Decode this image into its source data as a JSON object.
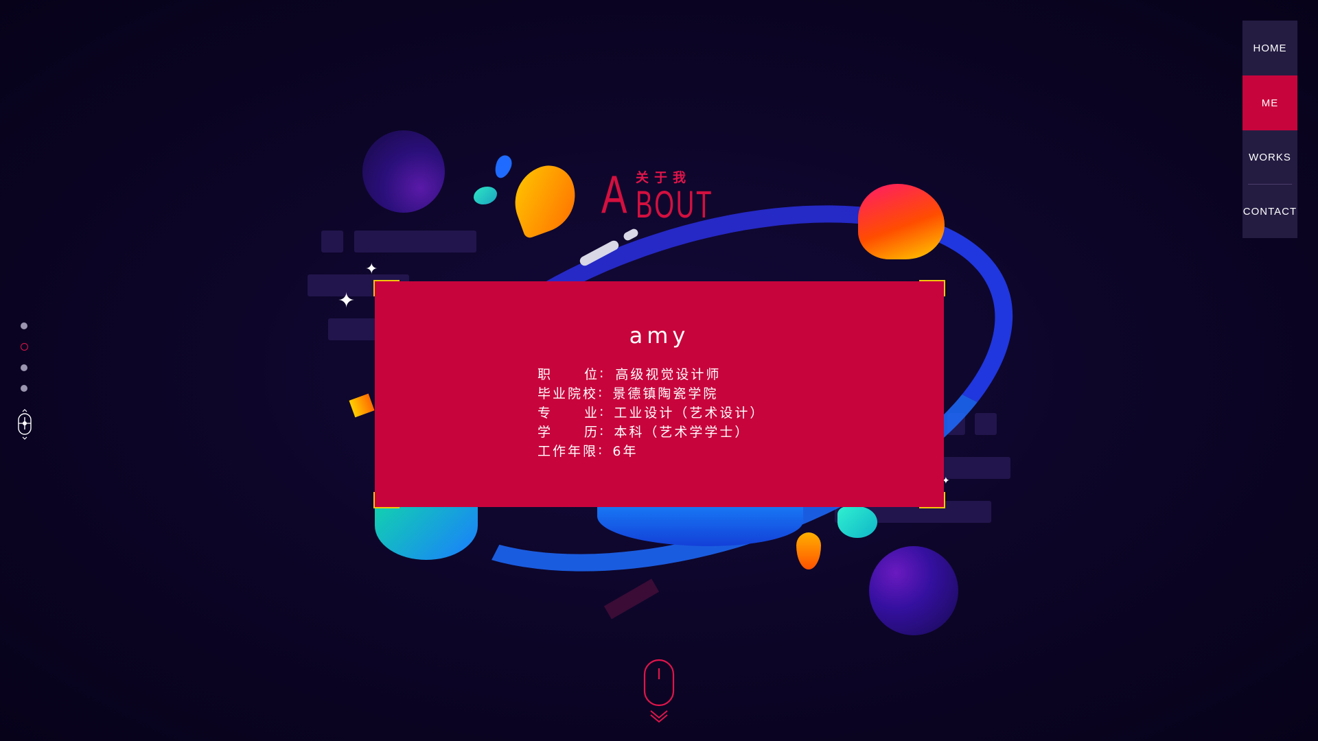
{
  "about": {
    "cn_label": "关于我",
    "cap_letter": "A",
    "rest_letters": "BOUT"
  },
  "card": {
    "name": "amy",
    "rows": [
      {
        "k1": "职",
        "k2": "位",
        "sep": ":",
        "value": "高级视觉设计师"
      },
      {
        "key": "毕业院校",
        "sep": ":",
        "value": "景德镇陶瓷学院"
      },
      {
        "k1": "专",
        "k2": "业",
        "sep": ":",
        "value": "工业设计（艺术设计）"
      },
      {
        "k1": "学",
        "k2": "历",
        "sep": ":",
        "value": "本科（艺术学学士）"
      },
      {
        "key": "工作年限",
        "sep": ":",
        "value": "6年"
      }
    ]
  },
  "nav": {
    "items": [
      {
        "label": "HOME",
        "active": false
      },
      {
        "label": "ME",
        "active": true
      },
      {
        "label": "WORKS",
        "active": false
      },
      {
        "label": "CONTACT",
        "active": false
      }
    ]
  },
  "page_dots": {
    "count": 4,
    "active_index": 1
  },
  "colors": {
    "accent": "#c8043c",
    "background": "#0c0526",
    "nav_bg": "#251c42",
    "corner": "#f2c80a"
  }
}
